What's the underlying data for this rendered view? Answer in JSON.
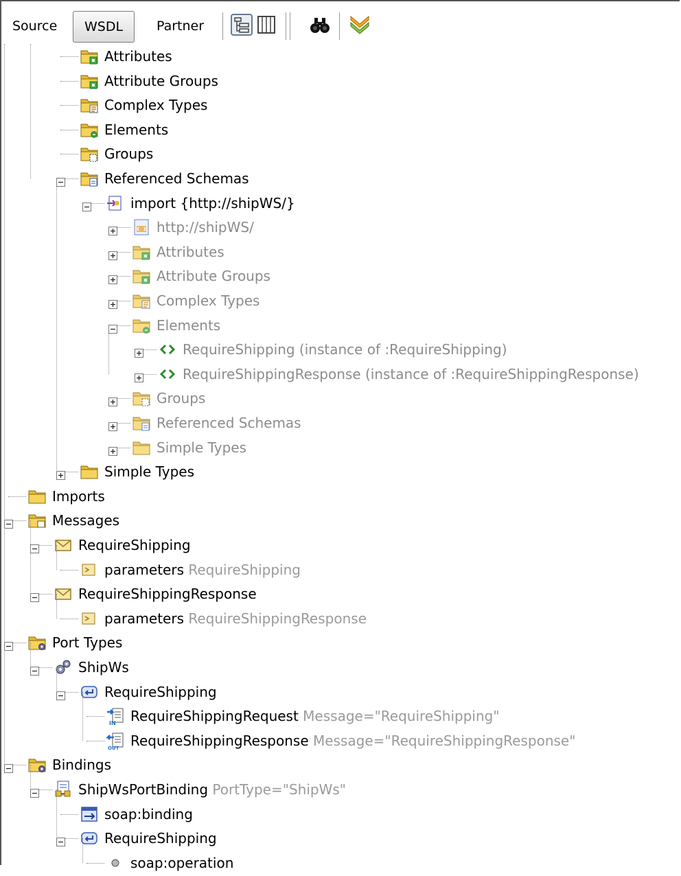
{
  "toolbar": {
    "source_label": "Source",
    "wsdl_label": "WSDL",
    "partner_label": "Partner",
    "icons": [
      "tree-view-icon",
      "column-view-icon",
      "binoculars-icon",
      "chevron-down-icon"
    ]
  },
  "tree": [
    {
      "label": "Attributes",
      "icon": "folder",
      "mark": "attr",
      "depth": 2,
      "exp": null,
      "gray": false
    },
    {
      "label": "Attribute Groups",
      "icon": "folder",
      "mark": "attr",
      "depth": 2,
      "exp": null,
      "gray": false
    },
    {
      "label": "Complex Types",
      "icon": "folder",
      "mark": "complex",
      "depth": 2,
      "exp": null,
      "gray": false
    },
    {
      "label": "Elements",
      "icon": "folder",
      "mark": "elem",
      "depth": 2,
      "exp": null,
      "gray": false
    },
    {
      "label": "Groups",
      "icon": "folder",
      "mark": "group",
      "depth": 2,
      "exp": null,
      "gray": false
    },
    {
      "label": "Referenced Schemas",
      "icon": "folder",
      "mark": "ref",
      "depth": 2,
      "exp": "minus",
      "gray": false
    },
    {
      "label": "import {http://shipWS/}",
      "icon": "import",
      "depth": 3,
      "exp": "minus",
      "gray": false
    },
    {
      "label": "http://shipWS/",
      "icon": "schema",
      "depth": 4,
      "exp": "plus",
      "gray": true
    },
    {
      "label": "Attributes",
      "icon": "folder",
      "mark": "attr",
      "depth": 4,
      "exp": "plus",
      "gray": true
    },
    {
      "label": "Attribute Groups",
      "icon": "folder",
      "mark": "attr",
      "depth": 4,
      "exp": "plus",
      "gray": true
    },
    {
      "label": "Complex Types",
      "icon": "folder",
      "mark": "complex",
      "depth": 4,
      "exp": "plus",
      "gray": true
    },
    {
      "label": "Elements",
      "icon": "folder",
      "mark": "elem",
      "depth": 4,
      "exp": "minus",
      "gray": true
    },
    {
      "label": "RequireShipping (instance of :RequireShipping)",
      "icon": "element",
      "depth": 5,
      "exp": "plus",
      "gray": true
    },
    {
      "label": "RequireShippingResponse (instance of :RequireShippingResponse)",
      "icon": "element",
      "depth": 5,
      "exp": "plus",
      "gray": true
    },
    {
      "label": "Groups",
      "icon": "folder",
      "mark": "group",
      "depth": 4,
      "exp": "plus",
      "gray": true
    },
    {
      "label": "Referenced Schemas",
      "icon": "folder",
      "mark": "ref",
      "depth": 4,
      "exp": "plus",
      "gray": true
    },
    {
      "label": "Simple Types",
      "icon": "folder",
      "mark": "simple",
      "depth": 4,
      "exp": "plus",
      "gray": true
    },
    {
      "label": "Simple Types",
      "icon": "folder",
      "mark": "simple",
      "depth": 2,
      "exp": "plus",
      "gray": false
    },
    {
      "label": "Imports",
      "icon": "folder",
      "mark": "none",
      "depth": 0,
      "exp": null,
      "gray": false
    },
    {
      "label": "Messages",
      "icon": "folder",
      "mark": "msg",
      "depth": 0,
      "exp": "minus",
      "gray": false
    },
    {
      "label": "RequireShipping",
      "icon": "envelope",
      "depth": 1,
      "exp": "minus",
      "gray": false
    },
    {
      "label": "parameters",
      "meta": "RequireShipping",
      "icon": "part",
      "depth": 2,
      "exp": null,
      "gray": false
    },
    {
      "label": "RequireShippingResponse",
      "icon": "envelope",
      "depth": 1,
      "exp": "minus",
      "gray": false
    },
    {
      "label": "parameters",
      "meta": "RequireShippingResponse",
      "icon": "part",
      "depth": 2,
      "exp": null,
      "gray": false
    },
    {
      "label": "Port Types",
      "icon": "folder",
      "mark": "gear",
      "depth": 0,
      "exp": "minus",
      "gray": false
    },
    {
      "label": "ShipWs",
      "icon": "gears",
      "depth": 1,
      "exp": "minus",
      "gray": false
    },
    {
      "label": "RequireShipping",
      "icon": "operation",
      "depth": 2,
      "exp": "minus",
      "gray": false
    },
    {
      "label": "RequireShippingRequest",
      "meta": "Message=\"RequireShipping\"",
      "icon": "input",
      "depth": 3,
      "exp": null,
      "gray": false
    },
    {
      "label": "RequireShippingResponse",
      "meta": "Message=\"RequireShippingResponse\"",
      "icon": "output",
      "depth": 3,
      "exp": null,
      "gray": false
    },
    {
      "label": "Bindings",
      "icon": "folder",
      "mark": "gear",
      "depth": 0,
      "exp": "minus",
      "gray": false
    },
    {
      "label": "ShipWsPortBinding",
      "meta": "PortType=\"ShipWs\"",
      "icon": "binding",
      "depth": 1,
      "exp": "minus",
      "gray": false
    },
    {
      "label": "soap:binding",
      "icon": "soap",
      "depth": 2,
      "exp": null,
      "gray": false
    },
    {
      "label": "RequireShipping",
      "icon": "operation",
      "depth": 2,
      "exp": "minus",
      "gray": false
    },
    {
      "label": "soap:operation",
      "icon": "dot",
      "depth": 3,
      "exp": null,
      "gray": false
    }
  ]
}
